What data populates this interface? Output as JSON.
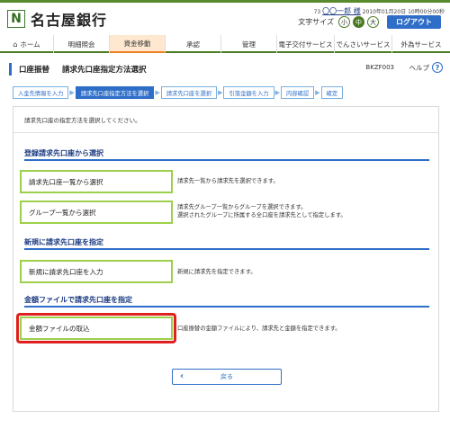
{
  "header": {
    "logo_mark": "N",
    "bank_name": "名古屋銀行",
    "user_prefix": "73",
    "user_name": "〇〇一郎 様",
    "datetime": "2010年01月20日 10時00分00秒",
    "font_size_label": "文字サイズ",
    "font_small": "小",
    "font_medium": "中",
    "font_large": "大",
    "logout_label": "ログアウト"
  },
  "nav": {
    "items": [
      {
        "label": "ホーム",
        "icon": "home-icon"
      },
      {
        "label": "明細照会"
      },
      {
        "label": "資金移動"
      },
      {
        "label": "承認"
      },
      {
        "label": "管理"
      },
      {
        "label": "電子交付サービス"
      },
      {
        "label": "でんさいサービス"
      },
      {
        "label": "外為サービス"
      }
    ],
    "active_index": 2,
    "accent_color": "#f08020"
  },
  "page": {
    "category": "口座振替",
    "title": "請求先口座指定方法選択",
    "screen_id": "BKZF003",
    "help_label": "ヘルプ",
    "help_icon": "?"
  },
  "steps": [
    "入金先情報を入力",
    "請求先口座指定方法を選択",
    "請求先口座を選択",
    "引落金額を入力",
    "内容確認",
    "確定"
  ],
  "active_step": 1,
  "content": {
    "intro": "請求先口座の指定方法を選択してください。",
    "sections": [
      {
        "heading": "登録請求先口座から選択",
        "options": [
          {
            "label": "請求先口座一覧から選択",
            "desc": [
              "請求先一覧から請求先を選択できます。"
            ]
          },
          {
            "label": "グループ一覧から選択",
            "desc": [
              "請求先グループ一覧からグループを選択できます。",
              "選択されたグループに所属する全口座を請求先として指定します。"
            ]
          }
        ]
      },
      {
        "heading": "新規に請求先口座を指定",
        "options": [
          {
            "label": "新規に請求先口座を入力",
            "desc": [
              "新規に請求先を指定できます。"
            ]
          }
        ]
      },
      {
        "heading": "金額ファイルで請求先口座を指定",
        "options": [
          {
            "label": "金額ファイルの取込",
            "desc": [
              "口座振替の金額ファイルにより、請求先と金額を指定できます。"
            ]
          }
        ]
      }
    ],
    "back_label": "戻る",
    "back_icon": "chevron-left-icon"
  },
  "colors": {
    "brand_green": "#4a7a22",
    "primary_blue": "#2e6ec8",
    "option_border": "#9cd04a",
    "highlight_red": "#e02020"
  }
}
